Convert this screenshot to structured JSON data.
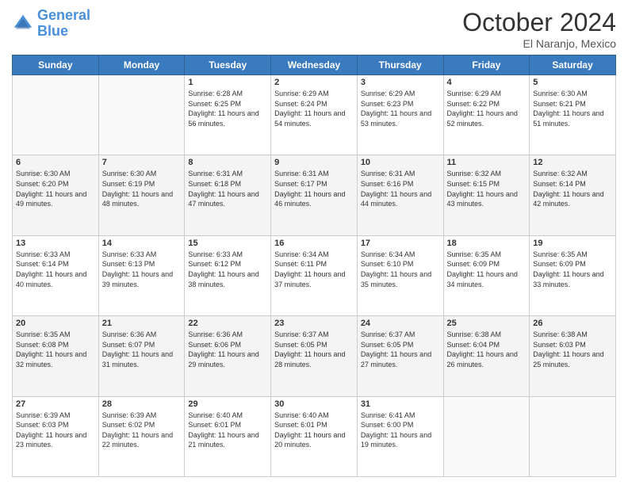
{
  "header": {
    "logo_line1": "General",
    "logo_line2": "Blue",
    "month": "October 2024",
    "location": "El Naranjo, Mexico"
  },
  "weekdays": [
    "Sunday",
    "Monday",
    "Tuesday",
    "Wednesday",
    "Thursday",
    "Friday",
    "Saturday"
  ],
  "weeks": [
    [
      {
        "day": "",
        "info": ""
      },
      {
        "day": "",
        "info": ""
      },
      {
        "day": "1",
        "info": "Sunrise: 6:28 AM\nSunset: 6:25 PM\nDaylight: 11 hours and 56 minutes."
      },
      {
        "day": "2",
        "info": "Sunrise: 6:29 AM\nSunset: 6:24 PM\nDaylight: 11 hours and 54 minutes."
      },
      {
        "day": "3",
        "info": "Sunrise: 6:29 AM\nSunset: 6:23 PM\nDaylight: 11 hours and 53 minutes."
      },
      {
        "day": "4",
        "info": "Sunrise: 6:29 AM\nSunset: 6:22 PM\nDaylight: 11 hours and 52 minutes."
      },
      {
        "day": "5",
        "info": "Sunrise: 6:30 AM\nSunset: 6:21 PM\nDaylight: 11 hours and 51 minutes."
      }
    ],
    [
      {
        "day": "6",
        "info": "Sunrise: 6:30 AM\nSunset: 6:20 PM\nDaylight: 11 hours and 49 minutes."
      },
      {
        "day": "7",
        "info": "Sunrise: 6:30 AM\nSunset: 6:19 PM\nDaylight: 11 hours and 48 minutes."
      },
      {
        "day": "8",
        "info": "Sunrise: 6:31 AM\nSunset: 6:18 PM\nDaylight: 11 hours and 47 minutes."
      },
      {
        "day": "9",
        "info": "Sunrise: 6:31 AM\nSunset: 6:17 PM\nDaylight: 11 hours and 46 minutes."
      },
      {
        "day": "10",
        "info": "Sunrise: 6:31 AM\nSunset: 6:16 PM\nDaylight: 11 hours and 44 minutes."
      },
      {
        "day": "11",
        "info": "Sunrise: 6:32 AM\nSunset: 6:15 PM\nDaylight: 11 hours and 43 minutes."
      },
      {
        "day": "12",
        "info": "Sunrise: 6:32 AM\nSunset: 6:14 PM\nDaylight: 11 hours and 42 minutes."
      }
    ],
    [
      {
        "day": "13",
        "info": "Sunrise: 6:33 AM\nSunset: 6:14 PM\nDaylight: 11 hours and 40 minutes."
      },
      {
        "day": "14",
        "info": "Sunrise: 6:33 AM\nSunset: 6:13 PM\nDaylight: 11 hours and 39 minutes."
      },
      {
        "day": "15",
        "info": "Sunrise: 6:33 AM\nSunset: 6:12 PM\nDaylight: 11 hours and 38 minutes."
      },
      {
        "day": "16",
        "info": "Sunrise: 6:34 AM\nSunset: 6:11 PM\nDaylight: 11 hours and 37 minutes."
      },
      {
        "day": "17",
        "info": "Sunrise: 6:34 AM\nSunset: 6:10 PM\nDaylight: 11 hours and 35 minutes."
      },
      {
        "day": "18",
        "info": "Sunrise: 6:35 AM\nSunset: 6:09 PM\nDaylight: 11 hours and 34 minutes."
      },
      {
        "day": "19",
        "info": "Sunrise: 6:35 AM\nSunset: 6:09 PM\nDaylight: 11 hours and 33 minutes."
      }
    ],
    [
      {
        "day": "20",
        "info": "Sunrise: 6:35 AM\nSunset: 6:08 PM\nDaylight: 11 hours and 32 minutes."
      },
      {
        "day": "21",
        "info": "Sunrise: 6:36 AM\nSunset: 6:07 PM\nDaylight: 11 hours and 31 minutes."
      },
      {
        "day": "22",
        "info": "Sunrise: 6:36 AM\nSunset: 6:06 PM\nDaylight: 11 hours and 29 minutes."
      },
      {
        "day": "23",
        "info": "Sunrise: 6:37 AM\nSunset: 6:05 PM\nDaylight: 11 hours and 28 minutes."
      },
      {
        "day": "24",
        "info": "Sunrise: 6:37 AM\nSunset: 6:05 PM\nDaylight: 11 hours and 27 minutes."
      },
      {
        "day": "25",
        "info": "Sunrise: 6:38 AM\nSunset: 6:04 PM\nDaylight: 11 hours and 26 minutes."
      },
      {
        "day": "26",
        "info": "Sunrise: 6:38 AM\nSunset: 6:03 PM\nDaylight: 11 hours and 25 minutes."
      }
    ],
    [
      {
        "day": "27",
        "info": "Sunrise: 6:39 AM\nSunset: 6:03 PM\nDaylight: 11 hours and 23 minutes."
      },
      {
        "day": "28",
        "info": "Sunrise: 6:39 AM\nSunset: 6:02 PM\nDaylight: 11 hours and 22 minutes."
      },
      {
        "day": "29",
        "info": "Sunrise: 6:40 AM\nSunset: 6:01 PM\nDaylight: 11 hours and 21 minutes."
      },
      {
        "day": "30",
        "info": "Sunrise: 6:40 AM\nSunset: 6:01 PM\nDaylight: 11 hours and 20 minutes."
      },
      {
        "day": "31",
        "info": "Sunrise: 6:41 AM\nSunset: 6:00 PM\nDaylight: 11 hours and 19 minutes."
      },
      {
        "day": "",
        "info": ""
      },
      {
        "day": "",
        "info": ""
      }
    ]
  ]
}
